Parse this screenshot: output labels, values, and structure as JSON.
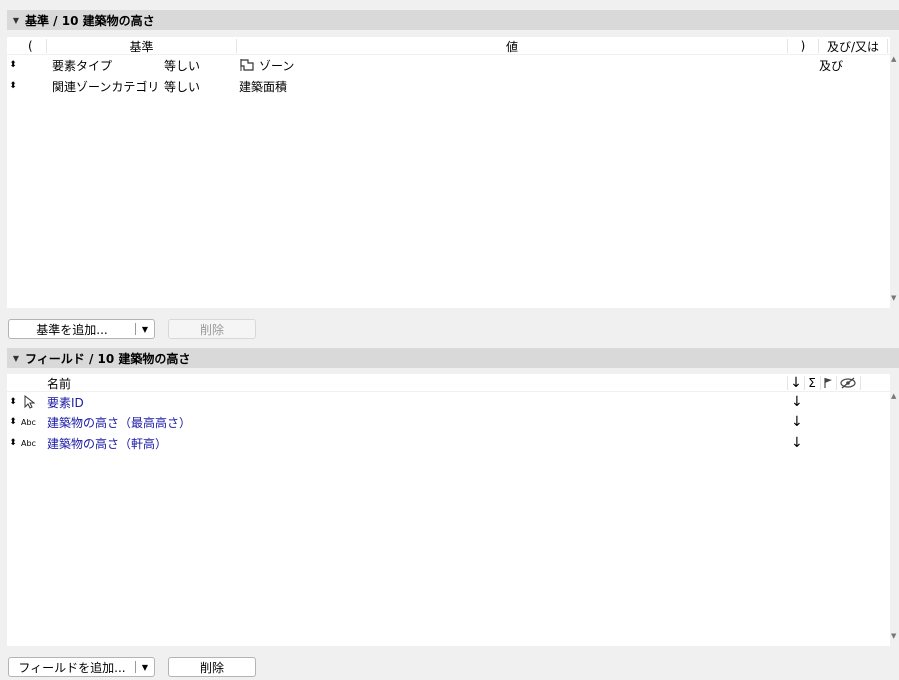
{
  "criteria": {
    "header": "基準 / 10 建築物の高さ",
    "columns": {
      "open_paren": "(",
      "criterion": "基準",
      "value": "値",
      "close_paren": ")",
      "and_or": "及び/又は"
    },
    "rows": [
      {
        "name": "要素タイプ",
        "op": "等しい",
        "value": "ゾーン",
        "value_icon": "zone-icon",
        "and_or": "及び"
      },
      {
        "name": "関連ゾーンカテゴリ",
        "op": "等しい",
        "value": "建築面積",
        "and_or": ""
      }
    ],
    "add_button": "基準を追加...",
    "delete_button": "削除"
  },
  "fields": {
    "header": "フィールド / 10 建築物の高さ",
    "columns": {
      "name": "名前",
      "sort": "↓",
      "sum": "Σ",
      "flag_icon": "flag-icon",
      "hide_icon": "hidden-eye-icon"
    },
    "rows": [
      {
        "icon": "pointer-icon",
        "name": "要素ID",
        "sort": "↓"
      },
      {
        "icon": "text-abc-icon",
        "icon_text": "Abc",
        "name": "建築物の高さ（最高高さ）",
        "sort": "↓"
      },
      {
        "icon": "text-abc-icon",
        "icon_text": "Abc",
        "name": "建築物の高さ（軒高）",
        "sort": "↓"
      }
    ],
    "add_button": "フィールドを追加...",
    "delete_button": "削除"
  }
}
